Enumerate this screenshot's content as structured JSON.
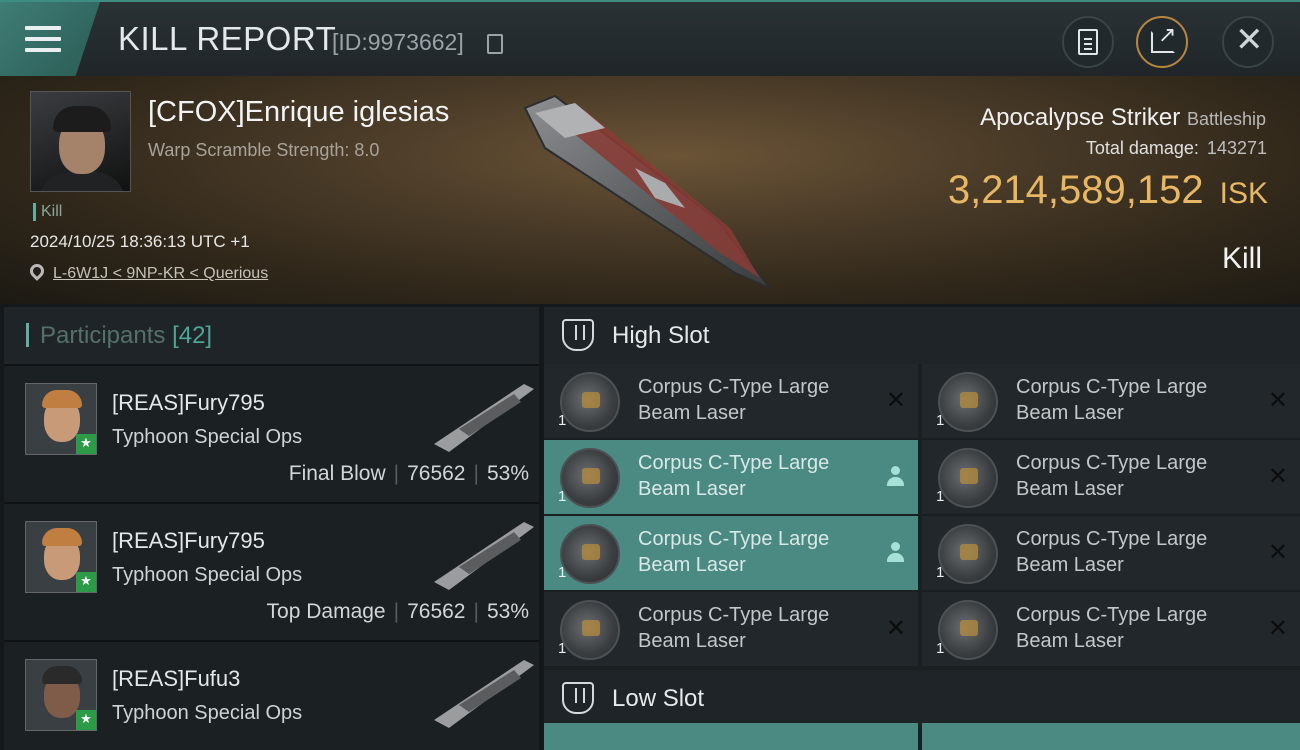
{
  "header": {
    "title": "KILL REPORT",
    "report_id": "[ID:9973662]",
    "icons": [
      "menu-icon",
      "copy-icon",
      "clipboard-icon",
      "share-icon",
      "close-icon"
    ]
  },
  "victim": {
    "name": "[CFOX]Enrique iglesias",
    "warp_scramble": "Warp Scramble Strength: 8.0",
    "tag": "Kill",
    "datetime": "2024/10/25 18:36:13 UTC +1",
    "location": "L-6W1J < 9NP-KR < Querious",
    "ship_name": "Apocalypse Striker",
    "ship_class": "Battleship",
    "total_damage_label": "Total damage:",
    "total_damage": "143271",
    "isk_value": "3,214,589,152",
    "isk_unit": "ISK",
    "result": "Kill"
  },
  "participants": {
    "label": "Participants",
    "count": "[42]",
    "rows": [
      {
        "name": "[REAS]Fury795",
        "ship": "Typhoon Special Ops",
        "stat_label": "Final Blow",
        "damage": "76562",
        "percent": "53%"
      },
      {
        "name": "[REAS]Fury795",
        "ship": "Typhoon Special Ops",
        "stat_label": "Top Damage",
        "damage": "76562",
        "percent": "53%"
      },
      {
        "name": "[REAS]Fufu3",
        "ship": "Typhoon Special Ops",
        "stat_label": "",
        "damage": "",
        "percent": ""
      }
    ]
  },
  "slots": {
    "high_label": "High Slot",
    "low_label": "Low Slot",
    "high_modules": [
      {
        "qty": "1",
        "name": "Corpus C-Type Large Beam Laser",
        "state": "destroyed"
      },
      {
        "qty": "1",
        "name": "Corpus C-Type Large Beam Laser",
        "state": "destroyed"
      },
      {
        "qty": "1",
        "name": "Corpus C-Type Large Beam Laser",
        "state": "dropped"
      },
      {
        "qty": "1",
        "name": "Corpus C-Type Large Beam Laser",
        "state": "destroyed"
      },
      {
        "qty": "1",
        "name": "Corpus C-Type Large Beam Laser",
        "state": "dropped"
      },
      {
        "qty": "1",
        "name": "Corpus C-Type Large Beam Laser",
        "state": "destroyed"
      },
      {
        "qty": "1",
        "name": "Corpus C-Type Large Beam Laser",
        "state": "destroyed"
      },
      {
        "qty": "1",
        "name": "Corpus C-Type Large Beam Laser",
        "state": "destroyed"
      }
    ]
  },
  "colors": {
    "accent": "#5fb0a2",
    "isk": "#e8b764",
    "active_module": "#4a8a82"
  }
}
